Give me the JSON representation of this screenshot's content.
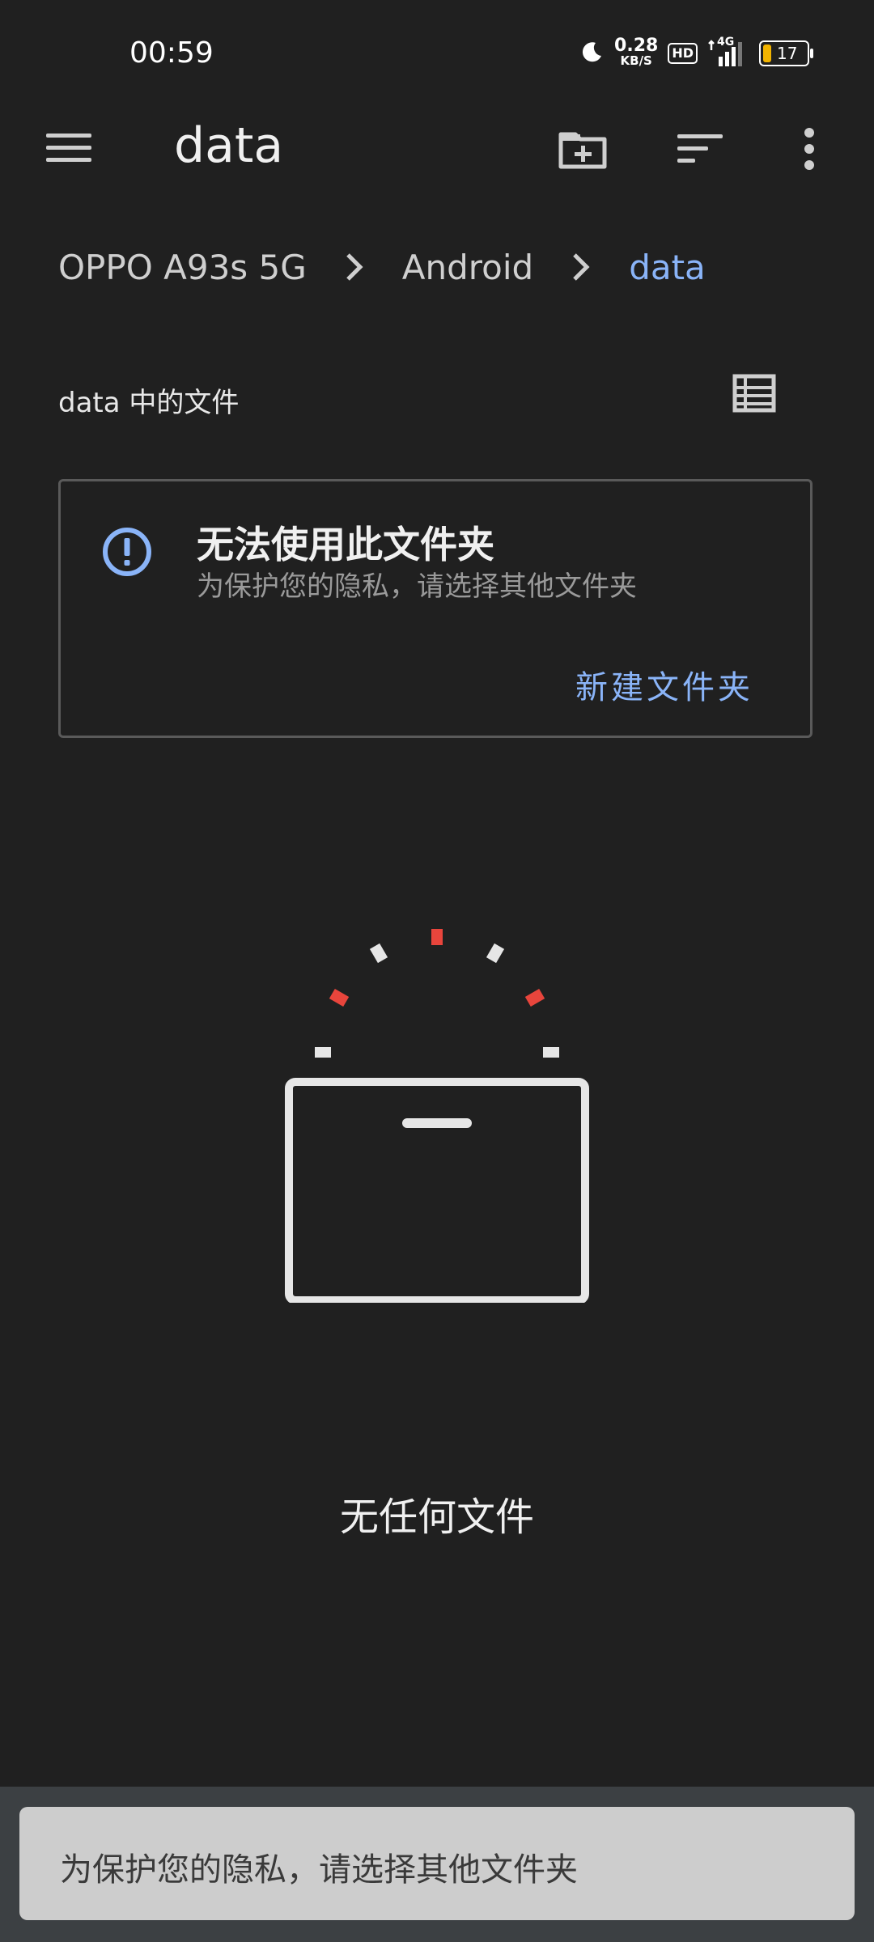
{
  "status_bar": {
    "time": "00:59",
    "net_speed_value": "0.28",
    "net_speed_unit": "KB/S",
    "hd_badge": "HD",
    "network": "4G",
    "battery_level": "17",
    "icons": [
      "moon-icon",
      "hd-icon",
      "signal-4g-icon",
      "battery-icon"
    ]
  },
  "app_bar": {
    "title": "data",
    "icons": [
      "menu-icon",
      "new-folder-icon",
      "sort-icon",
      "more-vert-icon"
    ]
  },
  "breadcrumb": [
    "OPPO A93s 5G",
    "Android",
    "data"
  ],
  "section": {
    "title": "data 中的文件"
  },
  "warning_card": {
    "title": "无法使用此文件夹",
    "subtitle": "为保护您的隐私，请选择其他文件夹",
    "action": "新建文件夹"
  },
  "empty_state": {
    "text": "无任何文件"
  },
  "snackbar": {
    "text": "为保护您的隐私，请选择其他文件夹"
  },
  "colors": {
    "background": "#202020",
    "accent": "#8ab4f8",
    "alert_red": "#e8453c",
    "snackbar_bg": "#cdcdcd"
  }
}
